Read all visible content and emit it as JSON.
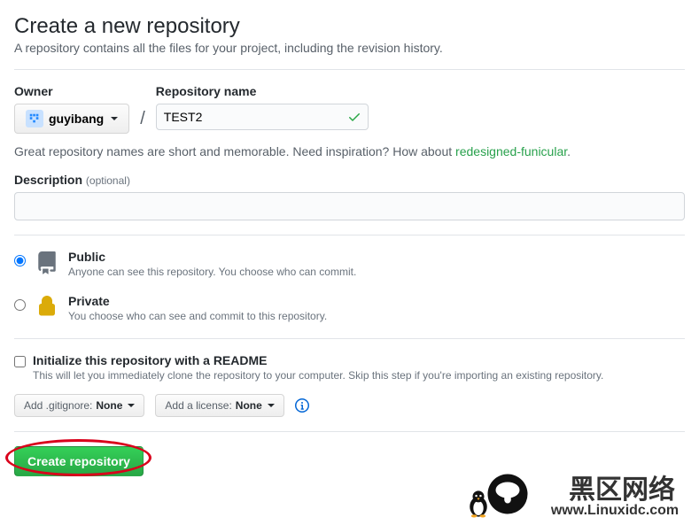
{
  "title": "Create a new repository",
  "subtitle": "A repository contains all the files for your project, including the revision history.",
  "owner": {
    "label": "Owner",
    "value": "guyibang"
  },
  "repo": {
    "label": "Repository name",
    "value": "TEST2"
  },
  "hint": {
    "prefix": "Great repository names are short and memorable. Need inspiration? How about ",
    "suggestion": "redesigned-funicular",
    "suffix": "."
  },
  "description": {
    "label": "Description",
    "optional": "(optional)",
    "value": ""
  },
  "visibility": {
    "public": {
      "title": "Public",
      "desc": "Anyone can see this repository. You choose who can commit."
    },
    "private": {
      "title": "Private",
      "desc": "You choose who can see and commit to this repository."
    }
  },
  "readme": {
    "title": "Initialize this repository with a README",
    "desc": "This will let you immediately clone the repository to your computer. Skip this step if you're importing an existing repository."
  },
  "gitignore": {
    "prefix": "Add .gitignore: ",
    "value": "None"
  },
  "license": {
    "prefix": "Add a license: ",
    "value": "None"
  },
  "create": "Create repository",
  "watermark": {
    "line1": "黑区网络",
    "line2": "www.Linuxidc.com"
  }
}
